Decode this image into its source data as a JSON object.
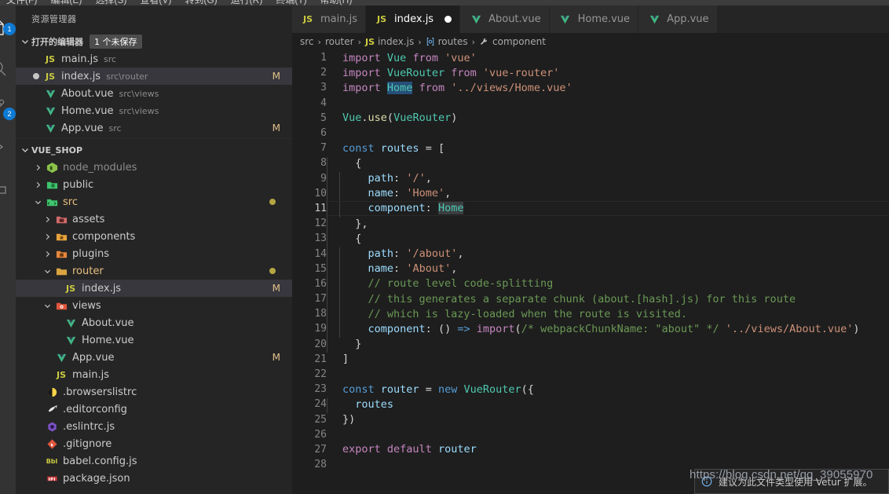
{
  "menubar": {
    "items": [
      "文件(F)",
      "编辑(E)",
      "选择(S)",
      "查看(V)",
      "转到(G)",
      "运行(R)",
      "终端(T)",
      "帮助(H)"
    ]
  },
  "activitybar": {
    "items": [
      {
        "name": "explorer-icon",
        "badge": "1"
      },
      {
        "name": "search-icon",
        "badge": ""
      },
      {
        "name": "source-control-icon",
        "badge": "2"
      },
      {
        "name": "run-debug-icon",
        "badge": ""
      },
      {
        "name": "extensions-icon",
        "badge": ""
      }
    ]
  },
  "sidebar": {
    "title": "资源管理器",
    "open_editors": {
      "label": "打开的编辑器",
      "badge": "1 个未保存",
      "items": [
        {
          "name": "main.js",
          "desc": "src",
          "icon": "js",
          "mark": "",
          "dirty": false,
          "selected": false
        },
        {
          "name": "index.js",
          "desc": "src\\router",
          "icon": "js",
          "mark": "M",
          "dirty": true,
          "selected": true
        },
        {
          "name": "About.vue",
          "desc": "src\\views",
          "icon": "vue",
          "mark": "",
          "dirty": false,
          "selected": false
        },
        {
          "name": "Home.vue",
          "desc": "src\\views",
          "icon": "vue",
          "mark": "",
          "dirty": false,
          "selected": false
        },
        {
          "name": "App.vue",
          "desc": "src",
          "icon": "vue",
          "mark": "M",
          "dirty": false,
          "selected": false
        }
      ]
    },
    "project": {
      "label": "VUE_SHOP",
      "items": [
        {
          "name": "node_modules",
          "type": "folder",
          "icon": "node",
          "indent": 2,
          "expanded": false,
          "mark": "",
          "dot": false,
          "selected": false
        },
        {
          "name": "public",
          "type": "folder",
          "icon": "public",
          "indent": 2,
          "expanded": false,
          "mark": "",
          "dot": false,
          "selected": false
        },
        {
          "name": "src",
          "type": "folder",
          "icon": "src",
          "indent": 2,
          "expanded": true,
          "mark": "",
          "dot": true,
          "selected": false
        },
        {
          "name": "assets",
          "type": "folder",
          "icon": "assets",
          "indent": 3,
          "expanded": false,
          "mark": "",
          "dot": false,
          "selected": false
        },
        {
          "name": "components",
          "type": "folder",
          "icon": "comp",
          "indent": 3,
          "expanded": false,
          "mark": "",
          "dot": false,
          "selected": false
        },
        {
          "name": "plugins",
          "type": "folder",
          "icon": "plugin",
          "indent": 3,
          "expanded": false,
          "mark": "",
          "dot": false,
          "selected": false
        },
        {
          "name": "router",
          "type": "folder",
          "icon": "router",
          "indent": 3,
          "expanded": true,
          "mark": "",
          "dot": true,
          "selected": false
        },
        {
          "name": "index.js",
          "type": "file",
          "icon": "js",
          "indent": 4,
          "expanded": false,
          "mark": "M",
          "dot": false,
          "selected": true
        },
        {
          "name": "views",
          "type": "folder",
          "icon": "views",
          "indent": 3,
          "expanded": true,
          "mark": "",
          "dot": false,
          "selected": false
        },
        {
          "name": "About.vue",
          "type": "file",
          "icon": "vue",
          "indent": 4,
          "expanded": false,
          "mark": "",
          "dot": false,
          "selected": false
        },
        {
          "name": "Home.vue",
          "type": "file",
          "icon": "vue",
          "indent": 4,
          "expanded": false,
          "mark": "",
          "dot": false,
          "selected": false
        },
        {
          "name": "App.vue",
          "type": "file",
          "icon": "vue",
          "indent": 3,
          "expanded": false,
          "mark": "M",
          "dot": false,
          "selected": false
        },
        {
          "name": "main.js",
          "type": "file",
          "icon": "js",
          "indent": 3,
          "expanded": false,
          "mark": "",
          "dot": false,
          "selected": false
        },
        {
          "name": ".browserslistrc",
          "type": "file",
          "icon": "browsers",
          "indent": 2,
          "expanded": false,
          "mark": "",
          "dot": false,
          "selected": false
        },
        {
          "name": ".editorconfig",
          "type": "file",
          "icon": "editorconfig",
          "indent": 2,
          "expanded": false,
          "mark": "",
          "dot": false,
          "selected": false
        },
        {
          "name": ".eslintrc.js",
          "type": "file",
          "icon": "eslint",
          "indent": 2,
          "expanded": false,
          "mark": "",
          "dot": false,
          "selected": false
        },
        {
          "name": ".gitignore",
          "type": "file",
          "icon": "git",
          "indent": 2,
          "expanded": false,
          "mark": "",
          "dot": false,
          "selected": false
        },
        {
          "name": "babel.config.js",
          "type": "file",
          "icon": "babel",
          "indent": 2,
          "expanded": false,
          "mark": "",
          "dot": false,
          "selected": false
        },
        {
          "name": "package.json",
          "type": "file",
          "icon": "npm",
          "indent": 2,
          "expanded": false,
          "mark": "",
          "dot": false,
          "selected": false
        }
      ]
    }
  },
  "editor": {
    "tabs": [
      {
        "label": "main.js",
        "icon": "js",
        "active": false,
        "dirty": false
      },
      {
        "label": "index.js",
        "icon": "js",
        "active": true,
        "dirty": true
      },
      {
        "label": "About.vue",
        "icon": "vue",
        "active": false,
        "dirty": false
      },
      {
        "label": "Home.vue",
        "icon": "vue",
        "active": false,
        "dirty": false
      },
      {
        "label": "App.vue",
        "icon": "vue",
        "active": false,
        "dirty": false
      }
    ],
    "breadcrumb": [
      {
        "label": "src",
        "icon": ""
      },
      {
        "label": "router",
        "icon": ""
      },
      {
        "label": "index.js",
        "icon": "js"
      },
      {
        "label": "routes",
        "icon": "array"
      },
      {
        "label": "component",
        "icon": "property"
      }
    ],
    "line_numbers": [
      1,
      2,
      3,
      4,
      5,
      6,
      7,
      8,
      9,
      10,
      11,
      12,
      13,
      14,
      15,
      16,
      17,
      18,
      19,
      20,
      21,
      22,
      23,
      24,
      25,
      26,
      27,
      28
    ],
    "active_line": 11,
    "selection_text": "Home"
  },
  "toast": {
    "message": "建议为此文件类型使用 Vetur 扩展。",
    "icon": "info-icon"
  },
  "watermark": {
    "text": "https://blog.csdn.net/qq_39055970"
  },
  "colors": {
    "background": "#1e1e1e",
    "sidebar": "#252526",
    "activitybar": "#333333",
    "accent": "#0e7ad4",
    "selection": "#264f78",
    "modified": "#e2c08d",
    "vue_green": "#41b883",
    "js_yellow": "#cbcb41"
  }
}
